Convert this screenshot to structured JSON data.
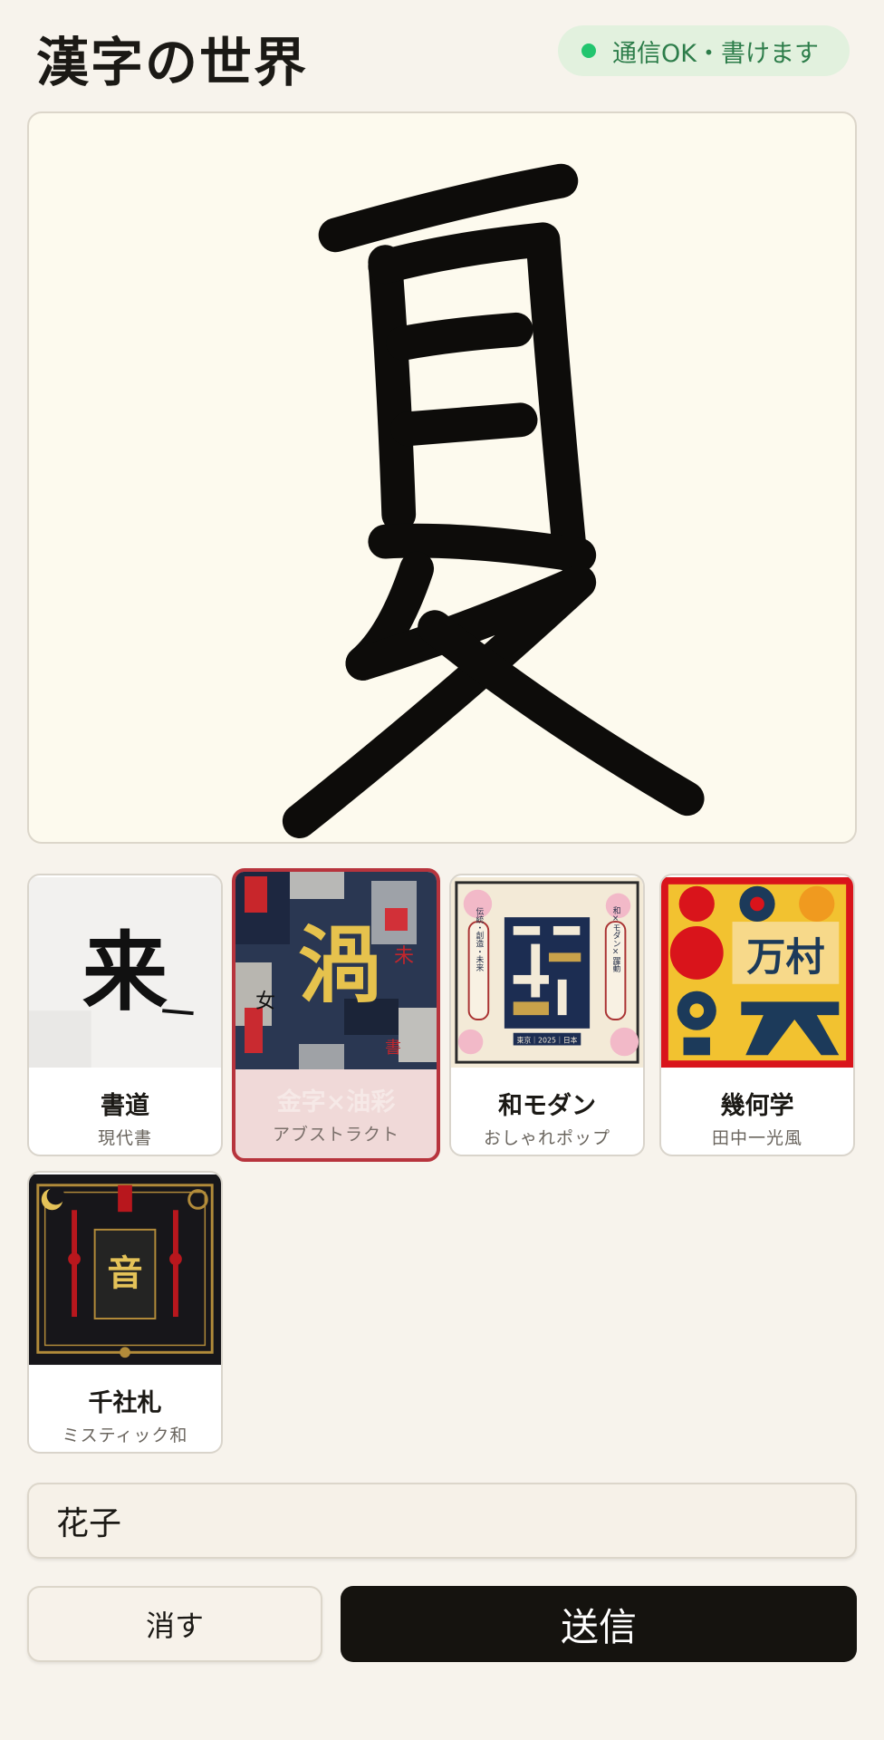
{
  "header": {
    "title": "漢字の世界",
    "status": "通信OK・書けます",
    "status_color": "#22c56e"
  },
  "canvas": {
    "drawn_character": "夏",
    "ink_color": "#0d0c0a",
    "paper_color": "#fdfaee"
  },
  "styles": [
    {
      "title": "書道",
      "subtitle": "現代書",
      "thumb_text": "来",
      "selected": false
    },
    {
      "title": "金字×油彩",
      "subtitle": "アブストラクト",
      "thumb_text": "渦",
      "selected": true
    },
    {
      "title": "和モダン",
      "subtitle": "おしゃれポップ",
      "thumb_text": "伝統・創造・未来",
      "thumb_text2": "和×モダン×躍動",
      "thumb_footer": "東京｜2025｜日本",
      "selected": false
    },
    {
      "title": "幾何学",
      "subtitle": "田中一光風",
      "thumb_text": "万村",
      "selected": false
    },
    {
      "title": "千社札",
      "subtitle": "ミスティック和",
      "thumb_text": "音",
      "selected": false
    }
  ],
  "name_input": {
    "value": "花子"
  },
  "buttons": {
    "clear": "消す",
    "send": "送信"
  },
  "colors": {
    "selected_border": "#b7343d",
    "send_bg": "#15130f"
  }
}
